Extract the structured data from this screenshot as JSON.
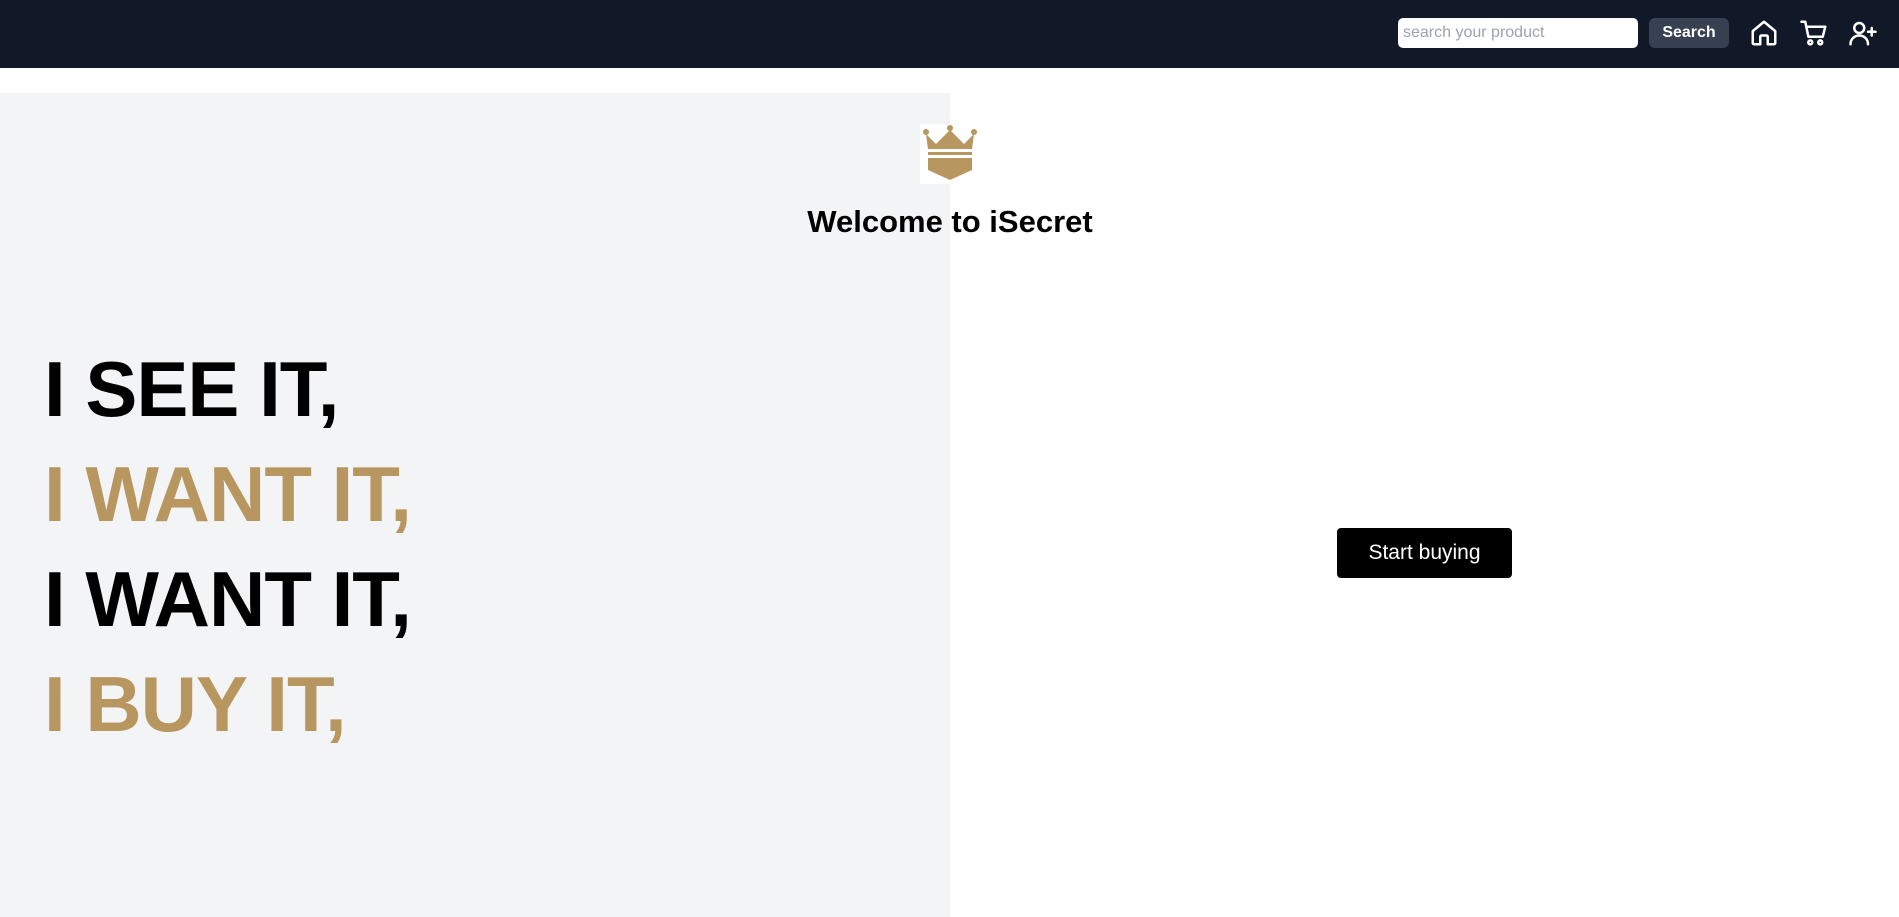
{
  "header": {
    "search": {
      "placeholder": "search your product",
      "value": ""
    },
    "search_button_label": "Search",
    "icons": [
      "home-icon",
      "cart-icon",
      "user-add-icon"
    ]
  },
  "hero": {
    "logo_icon": "crown-shield-icon",
    "title": "Welcome to iSecret",
    "slogan": [
      "I SEE IT,",
      "I WANT IT,",
      "I WANT IT,",
      "I BUY IT,"
    ],
    "cta_label": "Start buying"
  },
  "colors": {
    "navbar": "#111827",
    "search_button": "#374151",
    "left_panel": "#f3f4f6",
    "gold_accent": "#b8965f",
    "cta_button": "#000000"
  }
}
